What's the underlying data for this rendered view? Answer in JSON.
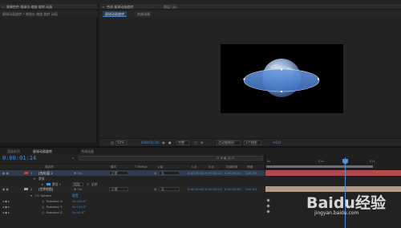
{
  "project_panel": {
    "header_text": "效果控件 地球仪 缩放 旋转 动画",
    "sub_text": "星球动画旋转 • 地球仪 缩放 旋转 动画"
  },
  "composition_panel": {
    "header_text": "合成 星球动画旋转",
    "right_header_text": "图层 (无)",
    "tabs": [
      "星球动画旋转",
      "合成动画"
    ]
  },
  "comp_toolbar": {
    "zoom": "50%",
    "time": "0:00:01:14",
    "resolution": "完整",
    "camera": "活动摄像机",
    "views": "1个视图",
    "offset": "+0.0"
  },
  "timeline": {
    "tabs": [
      "渲染队列",
      "星球动画旋转",
      "合成动画"
    ],
    "timecode": "0:00:01:14",
    "columns": [
      "源名称",
      "模式",
      "T TrkMat",
      "父级",
      "入点",
      "出点",
      "持续时间",
      "伸缩"
    ],
    "rows": [
      {
        "num": "1",
        "name": "[合成]蓝 2",
        "mode": "正常",
        "parent": "无",
        "in": "0:00:00:00",
        "out": "0:00:04:24",
        "dur": "0:00:05:00",
        "stretch": "100.0%",
        "color": "#b14b4e"
      },
      {
        "num": "",
        "name": "蒙版",
        "mode": "",
        "parent": "",
        "in": "",
        "out": "",
        "dur": "",
        "stretch": "",
        "color": ""
      },
      {
        "num": "",
        "name": "蒙版 1",
        "mode": "相加",
        "parent": "反转",
        "in": "",
        "out": "",
        "dur": "",
        "stretch": "",
        "color": ""
      },
      {
        "num": "",
        "name": "变换",
        "mode": "重置",
        "parent": "",
        "in": "",
        "out": "",
        "dur": "",
        "stretch": "",
        "color": ""
      },
      {
        "num": "2",
        "name": "[世界地图]",
        "mode": "正常",
        "parent": "无",
        "in": "0:00:00:00",
        "out": "0:00:04:24",
        "dur": "0:00:05:00",
        "stretch": "100.0%",
        "color": "#b19a87"
      },
      {
        "num": "",
        "name": "CC Sphere",
        "mode": "重置",
        "parent": "",
        "in": "",
        "out": "",
        "dur": "",
        "stretch": "",
        "color": ""
      },
      {
        "num": "",
        "name": "Rotation X",
        "mode": "0x+20.0°",
        "parent": "",
        "in": "",
        "out": "",
        "dur": "",
        "stretch": "",
        "color": ""
      },
      {
        "num": "",
        "name": "Rotation Y",
        "mode": "0x+10.0°",
        "parent": "",
        "in": "",
        "out": "",
        "dur": "",
        "stretch": "",
        "color": ""
      },
      {
        "num": "",
        "name": "Rotation Z",
        "mode": "0x+0.0°",
        "parent": "",
        "in": "",
        "out": "",
        "dur": "",
        "stretch": "",
        "color": ""
      }
    ],
    "ruler_labels": [
      "0s",
      "01s",
      "02s"
    ]
  },
  "watermark": {
    "brand": "Baidu经验",
    "url": "jingyan.baidu.com"
  },
  "colors": {
    "accent_blue": "#4f8fdc",
    "layer1_label": "#b14b4e",
    "layer2_label": "#b19a87"
  }
}
